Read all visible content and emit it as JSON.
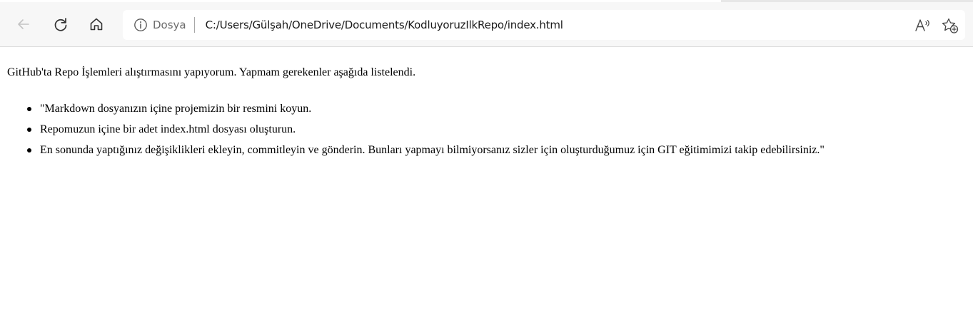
{
  "browser": {
    "scheme_label": "Dosya",
    "url": "C:/Users/Gülşah/OneDrive/Documents/KodluyoruzIlkRepo/index.html"
  },
  "icons": {
    "back": "back-arrow-icon",
    "refresh": "refresh-icon",
    "home": "home-icon",
    "info": "info-icon",
    "read_aloud": "read-aloud-icon",
    "favorites": "add-favorite-icon"
  },
  "page": {
    "intro": "GitHub'ta Repo İşlemleri alıştırmasını yapıyorum. Yapmam gerekenler aşağıda listelendi.",
    "items": [
      "\"Markdown dosyanızın içine projemizin bir resmini koyun.",
      "Repomuzun içine bir adet index.html dosyası oluşturun.",
      "En sonunda yaptığınız değişiklikleri ekleyin, commitleyin ve gönderin. Bunları yapmayı bilmiyorsanız sizler için oluşturduğumuz için GIT eğitimimizi takip edebilirsiniz.\""
    ]
  }
}
